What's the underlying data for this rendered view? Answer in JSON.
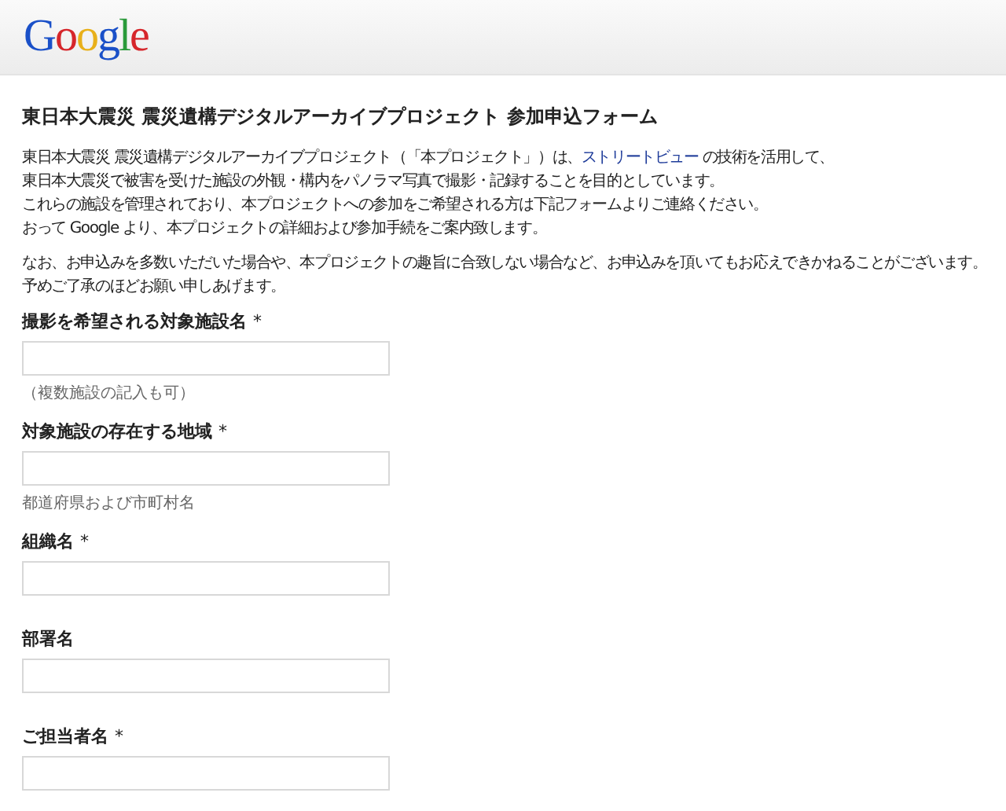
{
  "logo": [
    {
      "letter": "G",
      "color": "#1a50c8"
    },
    {
      "letter": "o",
      "color": "#d6262b"
    },
    {
      "letter": "o",
      "color": "#e8b01a"
    },
    {
      "letter": "g",
      "color": "#1a50c8"
    },
    {
      "letter": "l",
      "color": "#2a9a3a"
    },
    {
      "letter": "e",
      "color": "#d6262b"
    }
  ],
  "title": "東日本大震災 震災遺構デジタルアーカイブプロジェクト 参加申込フォーム",
  "paragraphs": [
    [
      {
        "before": "東日本大震災 震災遺構デジタルアーカイブプロジェクト（「本プロジェクト」）は、",
        "link": "ストリートビュー",
        "after": " の技術を活用して、"
      },
      {
        "before": "東日本大震災で被害を受けた施設の外観・構内をパノラマ写真で撮影・記録することを目的としています。"
      },
      {
        "before": "これらの施設を管理されており、本プロジェクトへの参加をご希望される方は下記フォームよりご連絡ください。"
      },
      {
        "before": "おって Google より、本プロジェクトの詳細および参加手続をご案内致します。"
      }
    ],
    [
      {
        "before": "なお、お申込みを多数いただいた場合や、本プロジェクトの趣旨に合致しない場合など、お申込みを頂いてもお応えできかねることがございます。"
      },
      {
        "before": "予めご了承のほどお願い申しあげます。"
      }
    ]
  ],
  "fields": [
    {
      "label": "撮影を希望される対象施設名",
      "required": true,
      "hint": "（複数施設の記入も可）"
    },
    {
      "label": "対象施設の存在する地域",
      "required": true,
      "hint": "都道府県および市町村名"
    },
    {
      "label": "組織名",
      "required": true
    },
    {
      "label": "部署名",
      "required": false
    },
    {
      "label": "ご担当者名",
      "required": true
    }
  ],
  "required_mark": "*"
}
